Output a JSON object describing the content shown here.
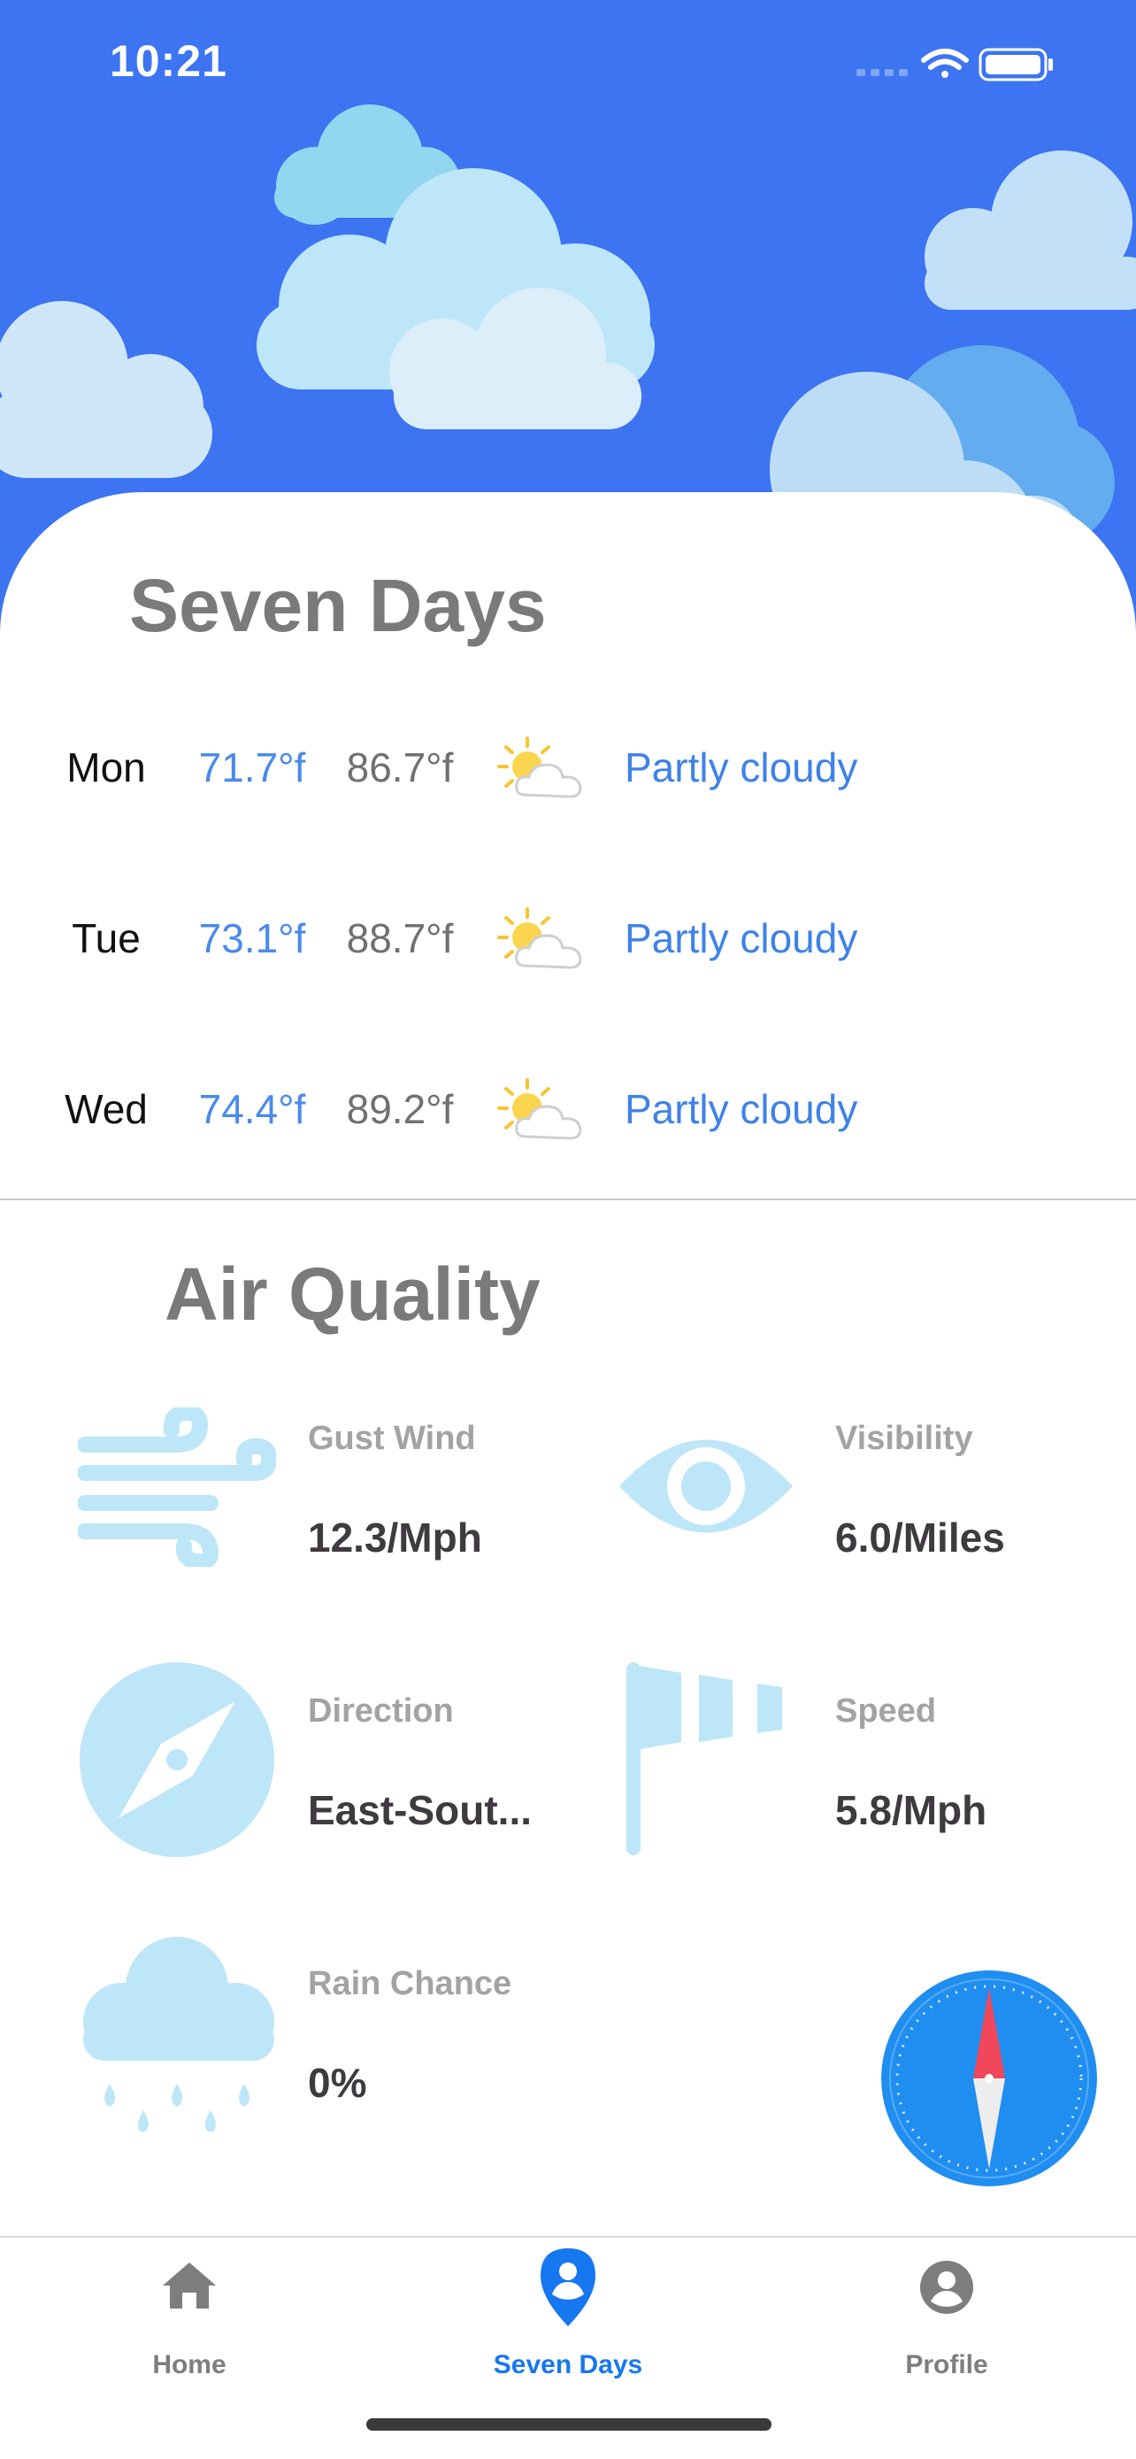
{
  "status_bar": {
    "time": "10:21"
  },
  "seven_days": {
    "title": "Seven Days",
    "days": [
      {
        "day": "Mon",
        "low": "71.7°f",
        "high": "86.7°f",
        "condition": "Partly cloudy",
        "icon": "partly-cloudy-icon"
      },
      {
        "day": "Tue",
        "low": "73.1°f",
        "high": "88.7°f",
        "condition": "Partly cloudy",
        "icon": "partly-cloudy-icon"
      },
      {
        "day": "Wed",
        "low": "74.4°f",
        "high": "89.2°f",
        "condition": "Partly cloudy",
        "icon": "partly-cloudy-icon"
      }
    ]
  },
  "air_quality": {
    "title": "Air Quality",
    "gust_wind": {
      "label": "Gust Wind",
      "value": "12.3/Mph",
      "icon": "wind-icon"
    },
    "visibility": {
      "label": "Visibility",
      "value": "6.0/Miles",
      "icon": "eye-icon"
    },
    "direction": {
      "label": "Direction",
      "value": "East-Sout...",
      "icon": "compass-icon"
    },
    "speed": {
      "label": "Speed",
      "value": "5.8/Mph",
      "icon": "windsock-icon"
    },
    "rain_chance": {
      "label": "Rain Chance",
      "value": "0%",
      "icon": "rain-cloud-icon"
    }
  },
  "tabs": [
    {
      "label": "Home",
      "icon": "home-icon",
      "active": false
    },
    {
      "label": "Seven Days",
      "icon": "location-person-icon",
      "active": true
    },
    {
      "label": "Profile",
      "icon": "profile-icon",
      "active": false
    }
  ],
  "colors": {
    "header_blue": "#3C74F1",
    "accent_blue": "#1677F0",
    "low_temp": "#4A8BEA",
    "icon_light_blue": "#BDE6F8"
  }
}
